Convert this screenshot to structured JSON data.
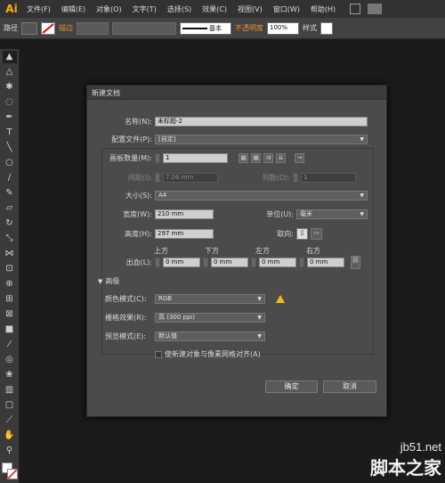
{
  "app": {
    "logo": "Ai"
  },
  "menubar": {
    "items": [
      "文件(F)",
      "编辑(E)",
      "对象(O)",
      "文字(T)",
      "选择(S)",
      "效果(C)",
      "视图(V)",
      "窗口(W)",
      "帮助(H)"
    ]
  },
  "optionsbar": {
    "path_label": "路径",
    "stroke_label": "描边",
    "stroke_style": "基本",
    "opacity_label": "不透明度",
    "opacity_value": "100%",
    "style_label": "样式"
  },
  "dialog": {
    "title": "新建文档",
    "name_label": "名称(N):",
    "name_value": "未标题-2",
    "profile_label": "配置文件(P):",
    "profile_value": "[自定]",
    "artboards_label": "画板数量(M):",
    "artboards_value": "1",
    "spacing_label": "间距(I):",
    "spacing_value": "7.06 mm",
    "columns_label": "列数(O):",
    "columns_value": "1",
    "size_label": "大小(S):",
    "size_value": "A4",
    "width_label": "宽度(W):",
    "width_value": "210 mm",
    "units_label": "单位(U):",
    "units_value": "毫米",
    "height_label": "高度(H):",
    "height_value": "297 mm",
    "orientation_label": "取向:",
    "bleed_label": "出血(L):",
    "bleed_top_label": "上方",
    "bleed_bottom_label": "下方",
    "bleed_left_label": "左方",
    "bleed_right_label": "右方",
    "bleed_top": "0 mm",
    "bleed_bottom": "0 mm",
    "bleed_left": "0 mm",
    "bleed_right": "0 mm",
    "advanced_label": "高级",
    "color_mode_label": "颜色模式(C):",
    "color_mode_value": "RGB",
    "raster_label": "栅格效果(R):",
    "raster_value": "高 (300 ppi)",
    "preview_label": "预览模式(E):",
    "preview_value": "默认值",
    "align_pixel_label": "使新建对象与像素网格对齐(A)",
    "ok_label": "确定",
    "cancel_label": "取消"
  },
  "watermark": {
    "line1": "jb51.net",
    "line2": "脚本之家"
  }
}
